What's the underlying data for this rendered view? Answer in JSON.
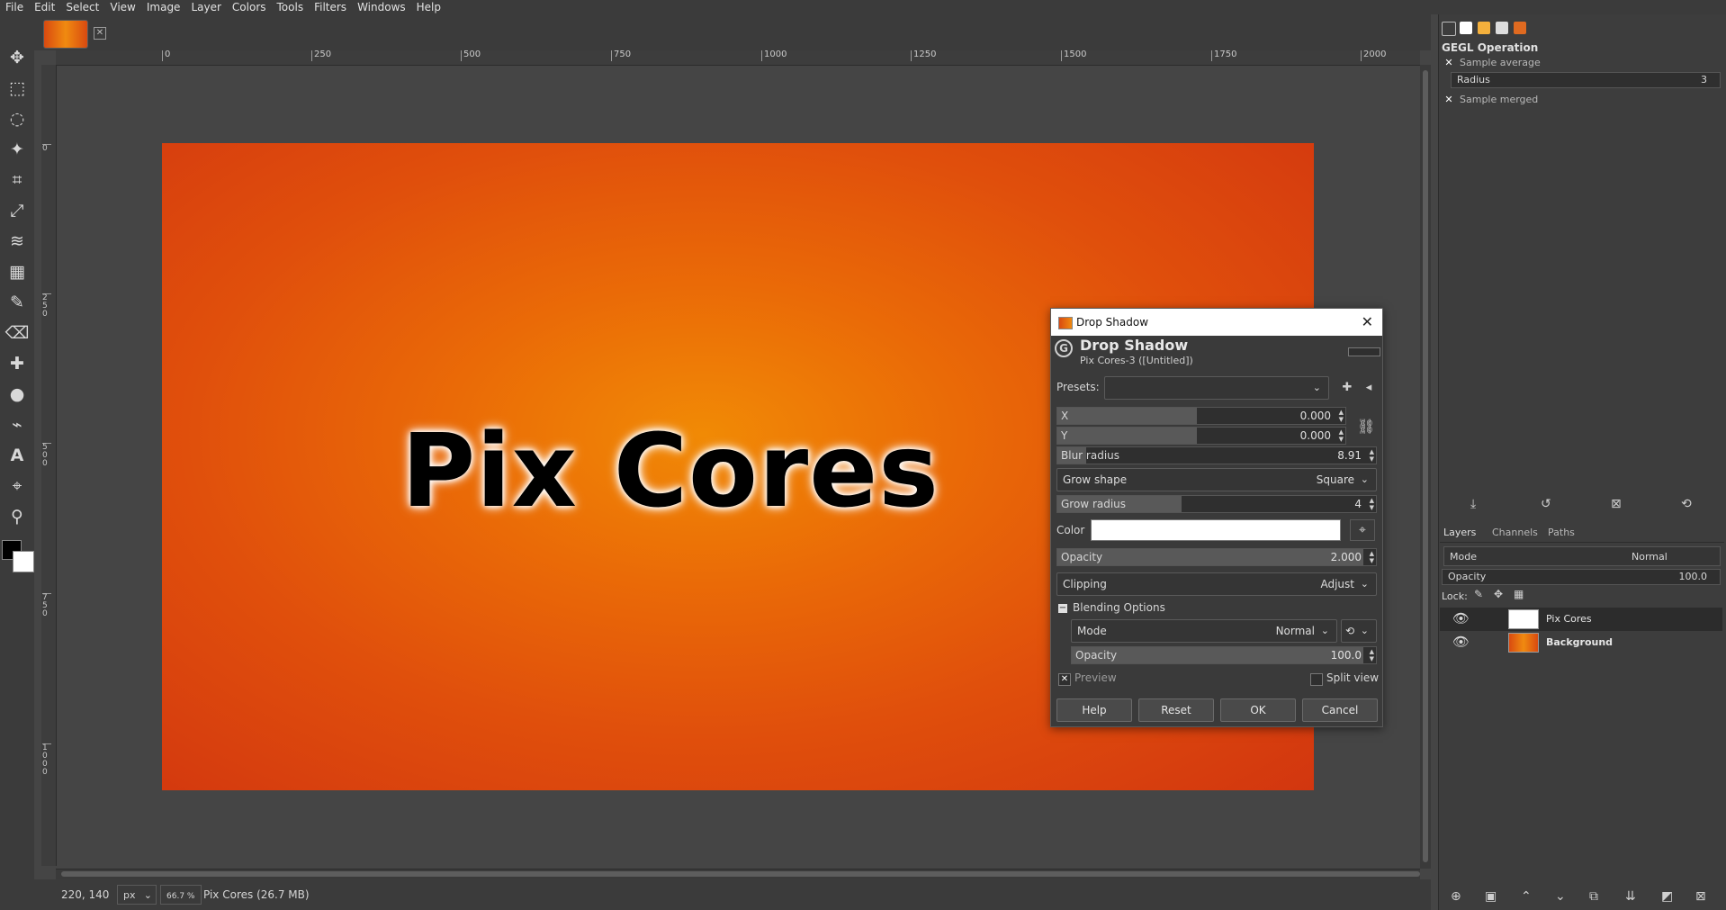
{
  "menubar": {
    "items": [
      "File",
      "Edit",
      "Select",
      "View",
      "Image",
      "Layer",
      "Colors",
      "Tools",
      "Filters",
      "Windows",
      "Help"
    ]
  },
  "tab": {
    "close_icon": "close-icon"
  },
  "ruler": {
    "h_ticks": [
      "0",
      "250",
      "500",
      "750",
      "1000",
      "1250",
      "1500",
      "1750",
      "2000"
    ],
    "v_ticks": [
      "0",
      "250",
      "500",
      "750",
      "1000"
    ]
  },
  "canvas": {
    "text": "Pix Cores"
  },
  "statusbar": {
    "coords": "220, 140",
    "unit": "px",
    "zoom": "66.7 %",
    "info": "Pix Cores (26.7 MB)"
  },
  "gegl_panel": {
    "title": "GEGL Operation",
    "sample_average_label": "Sample average",
    "radius_label": "Radius",
    "radius_value": "3",
    "sample_merged_label": "Sample merged",
    "sample_average_checked": true,
    "sample_merged_checked": true
  },
  "layers_panel": {
    "tabs": [
      "Layers",
      "Channels",
      "Paths"
    ],
    "mode_label": "Mode",
    "mode_value": "Normal",
    "opacity_label": "Opacity",
    "opacity_value": "100.0",
    "lock_label": "Lock:",
    "layers": [
      {
        "name": "Pix Cores",
        "selected": true
      },
      {
        "name": "Background",
        "selected": false
      }
    ]
  },
  "dialog": {
    "window_title": "Drop Shadow",
    "header_title": "Drop Shadow",
    "header_subtitle": "Pix Cores-3 ([Untitled])",
    "presets_label": "Presets:",
    "x_label": "X",
    "x_value": "0.000",
    "y_label": "Y",
    "y_value": "0.000",
    "blur_label": "Blur radius",
    "blur_value": "8.91",
    "grow_shape_label": "Grow shape",
    "grow_shape_value": "Square",
    "grow_radius_label": "Grow radius",
    "grow_radius_value": "4",
    "color_label": "Color",
    "color_value": "#ffffff",
    "opacity_label": "Opacity",
    "opacity_value": "2.000",
    "clipping_label": "Clipping",
    "clipping_value": "Adjust",
    "blending_label": "Blending Options",
    "mode_label": "Mode",
    "mode_value": "Normal",
    "blend_opacity_label": "Opacity",
    "blend_opacity_value": "100.0",
    "preview_label": "Preview",
    "split_view_label": "Split view",
    "buttons": {
      "help": "Help",
      "reset": "Reset",
      "ok": "OK",
      "cancel": "Cancel"
    }
  },
  "colors": {
    "accent": "#e86a08",
    "foreground": "#000000",
    "background": "#ffffff"
  }
}
